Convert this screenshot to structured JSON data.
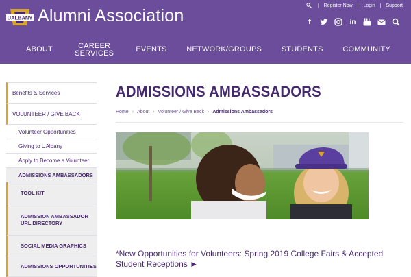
{
  "header": {
    "logo_text": "UALBANY",
    "title": "Alumni Association",
    "utility": {
      "register": "Register Now",
      "login": "Login",
      "support": "Support",
      "separator": "|"
    },
    "social_icons": [
      "facebook-icon",
      "twitter-icon",
      "instagram-icon",
      "linkedin-icon",
      "youtube-icon",
      "email-icon",
      "search-icon"
    ],
    "colors": {
      "header_bg": "#6b4d9b",
      "accent_gold": "#d9a42a",
      "brand_purple": "#46286e"
    }
  },
  "nav": {
    "items": [
      {
        "line1": "ABOUT",
        "line2": ""
      },
      {
        "line1": "CAREER",
        "line2": "SERVICES"
      },
      {
        "line1": "EVENTS",
        "line2": ""
      },
      {
        "line1": "NETWORK/GROUPS",
        "line2": ""
      },
      {
        "line1": "STUDENTS",
        "line2": ""
      },
      {
        "line1": "COMMUNITY",
        "line2": ""
      }
    ]
  },
  "sidebar": {
    "items": [
      {
        "label": "Benefits & Services"
      },
      {
        "label": "VOLUNTEER / GIVE BACK"
      },
      {
        "label": "Volunteer Opportunities"
      },
      {
        "label": "Giving to UAlbany"
      },
      {
        "label": "Apply to Become a Volunteer"
      },
      {
        "label": "ADMISSIONS AMBASSADORS"
      },
      {
        "label": "TOOL KIT"
      },
      {
        "label": "ADMISSION AMBASSADOR URL DIRECTORY"
      },
      {
        "label": "SOCIAL MEDIA GRAPHICS"
      },
      {
        "label": "ADMISSIONS OPPORTUNITIES"
      }
    ]
  },
  "main": {
    "title": "ADMISSIONS AMBASSADORS",
    "breadcrumb": [
      "Home",
      "About",
      "Volunteer / Give Back",
      "Admissions Ambassadors"
    ],
    "news_link": "*New Opportunities for Volunteers: Spring 2019 College Fairs & Accepted Student Receptions ►"
  }
}
